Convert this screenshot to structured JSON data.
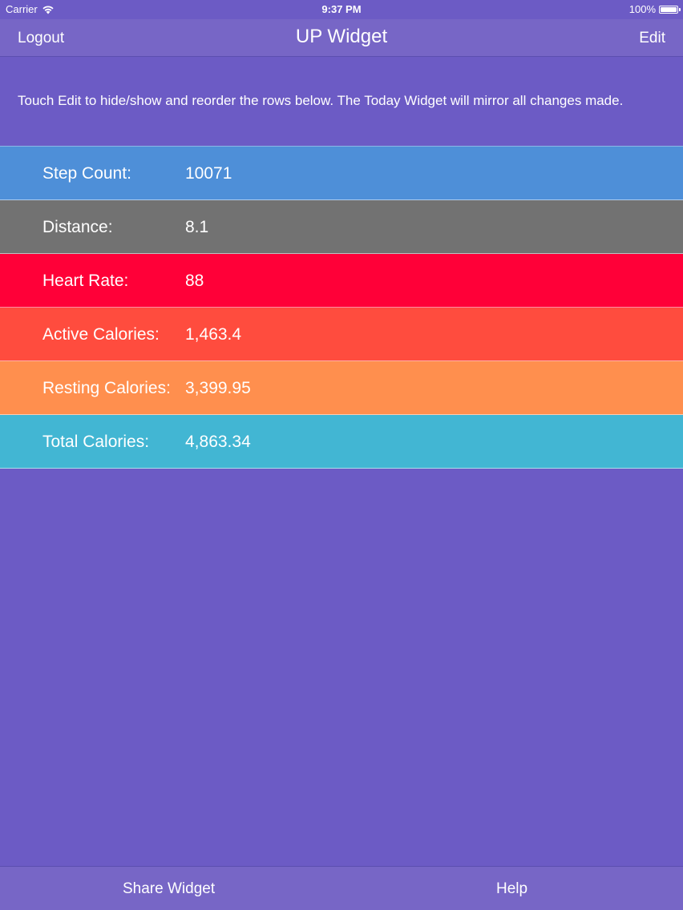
{
  "status_bar": {
    "carrier": "Carrier",
    "time": "9:37 PM",
    "battery": "100%",
    "icons": [
      "wifi-icon",
      "battery-icon"
    ]
  },
  "nav": {
    "left_label": "Logout",
    "title": "UP Widget",
    "right_label": "Edit"
  },
  "instructions": "Touch Edit to hide/show and reorder the rows below. The Today Widget will mirror all changes made.",
  "rows": [
    {
      "label": "Step Count:",
      "value": "10071",
      "color": "#4e8fd8"
    },
    {
      "label": "Distance:",
      "value": "8.1",
      "color": "#727272"
    },
    {
      "label": "Heart Rate:",
      "value": "88",
      "color": "#ff0038"
    },
    {
      "label": "Active Calories:",
      "value": "1,463.4",
      "color": "#ff4c3e"
    },
    {
      "label": "Resting Calories:",
      "value": "3,399.95",
      "color": "#ff8f4e"
    },
    {
      "label": "Total Calories:",
      "value": "4,863.34",
      "color": "#42b6d3"
    }
  ],
  "tab_bar": {
    "share_label": "Share Widget",
    "help_label": "Help"
  },
  "colors": {
    "background": "#6c5bc5",
    "bars": "#7766c6"
  }
}
